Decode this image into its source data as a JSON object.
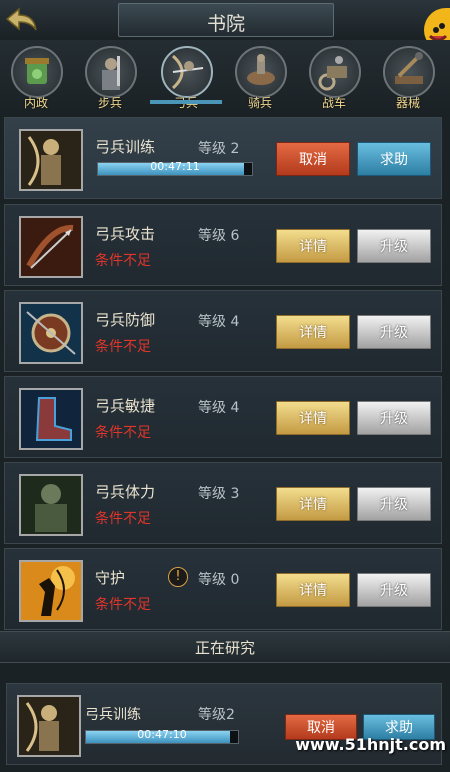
{
  "header": {
    "title": "书院"
  },
  "tabs": [
    {
      "label": "内政",
      "icon": "jade-treasure-icon"
    },
    {
      "label": "步兵",
      "icon": "infantry-icon"
    },
    {
      "label": "弓兵",
      "icon": "archer-icon",
      "active": true
    },
    {
      "label": "骑兵",
      "icon": "cavalry-icon"
    },
    {
      "label": "战车",
      "icon": "chariot-icon"
    },
    {
      "label": "器械",
      "icon": "siege-engine-icon"
    }
  ],
  "research": [
    {
      "name": "弓兵训练",
      "level": "等级 2",
      "timer": "00:47:11",
      "progress": 0.95,
      "buttons": [
        "取消",
        "求助"
      ]
    },
    {
      "name": "弓兵攻击",
      "level": "等级 6",
      "condition": "条件不足",
      "buttons": [
        "详情",
        "升级"
      ]
    },
    {
      "name": "弓兵防御",
      "level": "等级 4",
      "condition": "条件不足",
      "buttons": [
        "详情",
        "升级"
      ]
    },
    {
      "name": "弓兵敏捷",
      "level": "等级 4",
      "condition": "条件不足",
      "buttons": [
        "详情",
        "升级"
      ]
    },
    {
      "name": "弓兵体力",
      "level": "等级 3",
      "condition": "条件不足",
      "buttons": [
        "详情",
        "升级"
      ]
    },
    {
      "name": "守护",
      "level": "等级 0",
      "condition": "条件不足",
      "buttons": [
        "详情",
        "升级"
      ]
    }
  ],
  "researching": {
    "title": "正在研究",
    "name": "弓兵训练",
    "level": "等级2",
    "timer": "00:47:10",
    "progress": 0.95,
    "cancel": "取消",
    "help": "求助"
  },
  "watermark": "www.51hnjt.com"
}
